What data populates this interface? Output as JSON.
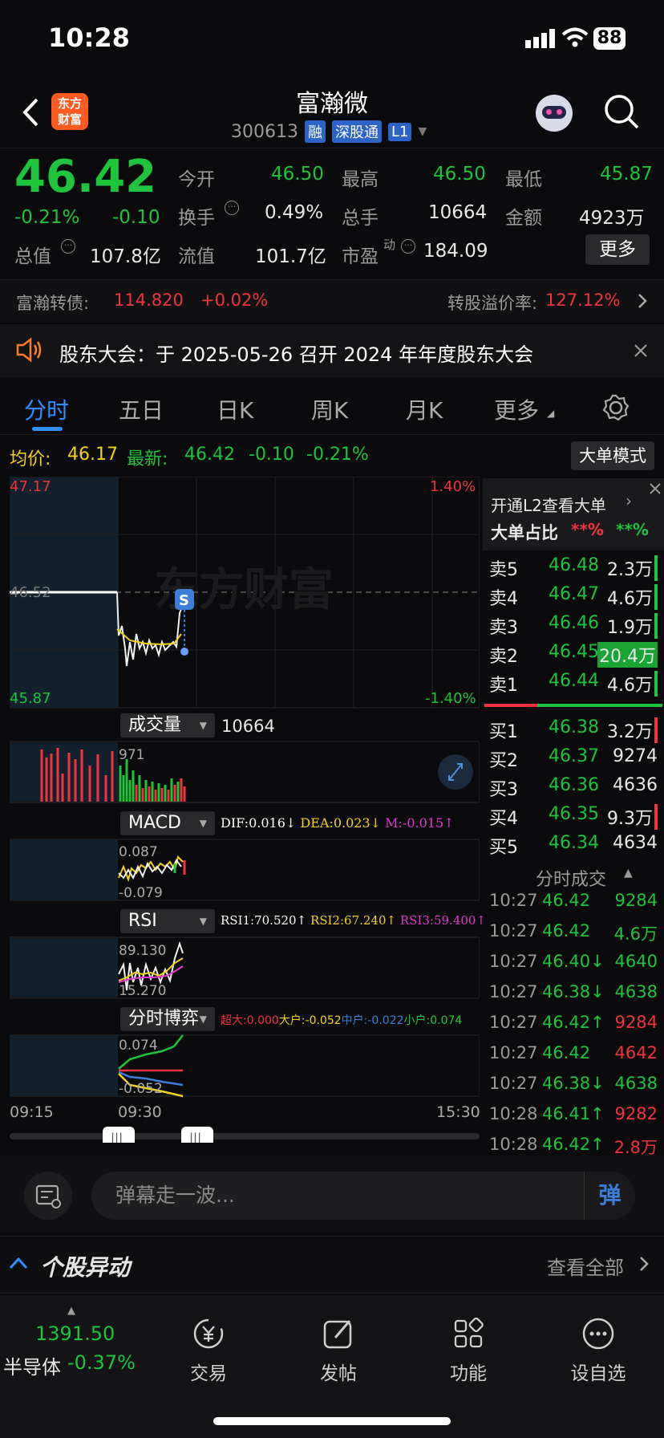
{
  "status": {
    "time": "10:28",
    "battery": "88"
  },
  "header": {
    "logo": "东方\n财富",
    "name": "富瀚微",
    "code": "300613",
    "tags": [
      "融",
      "深股通",
      "L1"
    ]
  },
  "quote": {
    "price": "46.42",
    "pct": "-0.21%",
    "chg": "-0.10",
    "open_label": "今开",
    "open": "46.50",
    "high_label": "最高",
    "high": "46.50",
    "low_label": "最低",
    "low": "45.87",
    "turnover_label": "换手",
    "turnover": "0.49%",
    "vol_label": "总手",
    "vol": "10664",
    "amt_label": "金额",
    "amt": "4923万",
    "mcap_label": "总值",
    "mcap": "107.8亿",
    "float_label": "流值",
    "float": "101.7亿",
    "pe_label": "市盈",
    "pe_sup": "动",
    "pe": "184.09",
    "more": "更多"
  },
  "bond": {
    "label": "富瀚转债:",
    "price": "114.820",
    "pct": "+0.02%",
    "premium_label": "转股溢价率:",
    "premium": "127.12%"
  },
  "notice": {
    "text": "股东大会：于 2025-05-26 召开 2024 年年度股东大会"
  },
  "tabs": [
    "分时",
    "五日",
    "日K",
    "周K",
    "月K",
    "更多"
  ],
  "avg": {
    "avg_label": "均价:",
    "avg": "46.17",
    "latest_label": "最新:",
    "latest": "46.42",
    "chg": "-0.10",
    "pct": "-0.21%",
    "mode": "大单模式"
  },
  "chart": {
    "top_price": "47.17",
    "mid_price": "46.52",
    "bottom_price": "45.87",
    "top_pct": "1.40%",
    "bottom_pct": "-1.40%",
    "watermark": "东方财富",
    "vol_label": "成交量",
    "vol_value": "10664",
    "vol_max": "971",
    "macd_label": "MACD",
    "macd_dif": "DIF:0.016↓",
    "macd_dea": "DEA:0.023↓",
    "macd_m": "M:-0.015↑",
    "macd_top": "0.087",
    "macd_bottom": "-0.079",
    "rsi_label": "RSI",
    "rsi1": "RSI1:70.520↑",
    "rsi2": "RSI2:67.240↑",
    "rsi3": "RSI3:59.400↑",
    "rsi_top": "89.130",
    "rsi_bottom": "15.270",
    "game_label": "分时博弈",
    "game_super": "超大:0.000",
    "game_big": "大户:-0.052",
    "game_mid": "中户:-0.022",
    "game_small": "小户:0.074",
    "game_top": "0.074",
    "game_bottom": "-0.052",
    "t_start": "09:15",
    "t_open": "09:30",
    "t_end": "15:30"
  },
  "book": {
    "promo": "开通L2查看大单",
    "ratio_label": "大单占比",
    "ratio_red": "**%",
    "ratio_green": "**%",
    "asks": [
      {
        "label": "卖5",
        "price": "46.48",
        "vol": "2.3万"
      },
      {
        "label": "卖4",
        "price": "46.47",
        "vol": "4.6万"
      },
      {
        "label": "卖3",
        "price": "46.46",
        "vol": "1.9万"
      },
      {
        "label": "卖2",
        "price": "46.45",
        "vol": "20.4万"
      },
      {
        "label": "卖1",
        "price": "46.44",
        "vol": "4.6万"
      }
    ],
    "bids": [
      {
        "label": "买1",
        "price": "46.38",
        "vol": "3.2万"
      },
      {
        "label": "买2",
        "price": "46.37",
        "vol": "9274"
      },
      {
        "label": "买3",
        "price": "46.36",
        "vol": "4636"
      },
      {
        "label": "买4",
        "price": "46.35",
        "vol": "9.3万"
      },
      {
        "label": "买5",
        "price": "46.34",
        "vol": "4634"
      }
    ],
    "ticks_label": "分时成交",
    "ticks": [
      {
        "t": "10:27",
        "p": "46.42",
        "v": "9284"
      },
      {
        "t": "10:27",
        "p": "46.42",
        "v": "4.6万"
      },
      {
        "t": "10:27",
        "p": "46.40↓",
        "v": "4640"
      },
      {
        "t": "10:27",
        "p": "46.38↓",
        "v": "4638"
      },
      {
        "t": "10:27",
        "p": "46.42↑",
        "v": "9284"
      },
      {
        "t": "10:27",
        "p": "46.42",
        "v": "4642"
      },
      {
        "t": "10:27",
        "p": "46.38↓",
        "v": "4638"
      },
      {
        "t": "10:28",
        "p": "46.41↑",
        "v": "9282"
      },
      {
        "t": "10:28",
        "p": "46.42↑",
        "v": "2.8万"
      }
    ]
  },
  "danmu": {
    "placeholder": "弹幕走一波...",
    "send": "弹"
  },
  "movers": {
    "title": "个股异动",
    "all": "查看全部"
  },
  "tabbar": {
    "index_value": "1391.50",
    "index_name": "半导体",
    "index_pct": "-0.37%",
    "items": [
      "交易",
      "发帖",
      "功能",
      "设自选"
    ]
  }
}
